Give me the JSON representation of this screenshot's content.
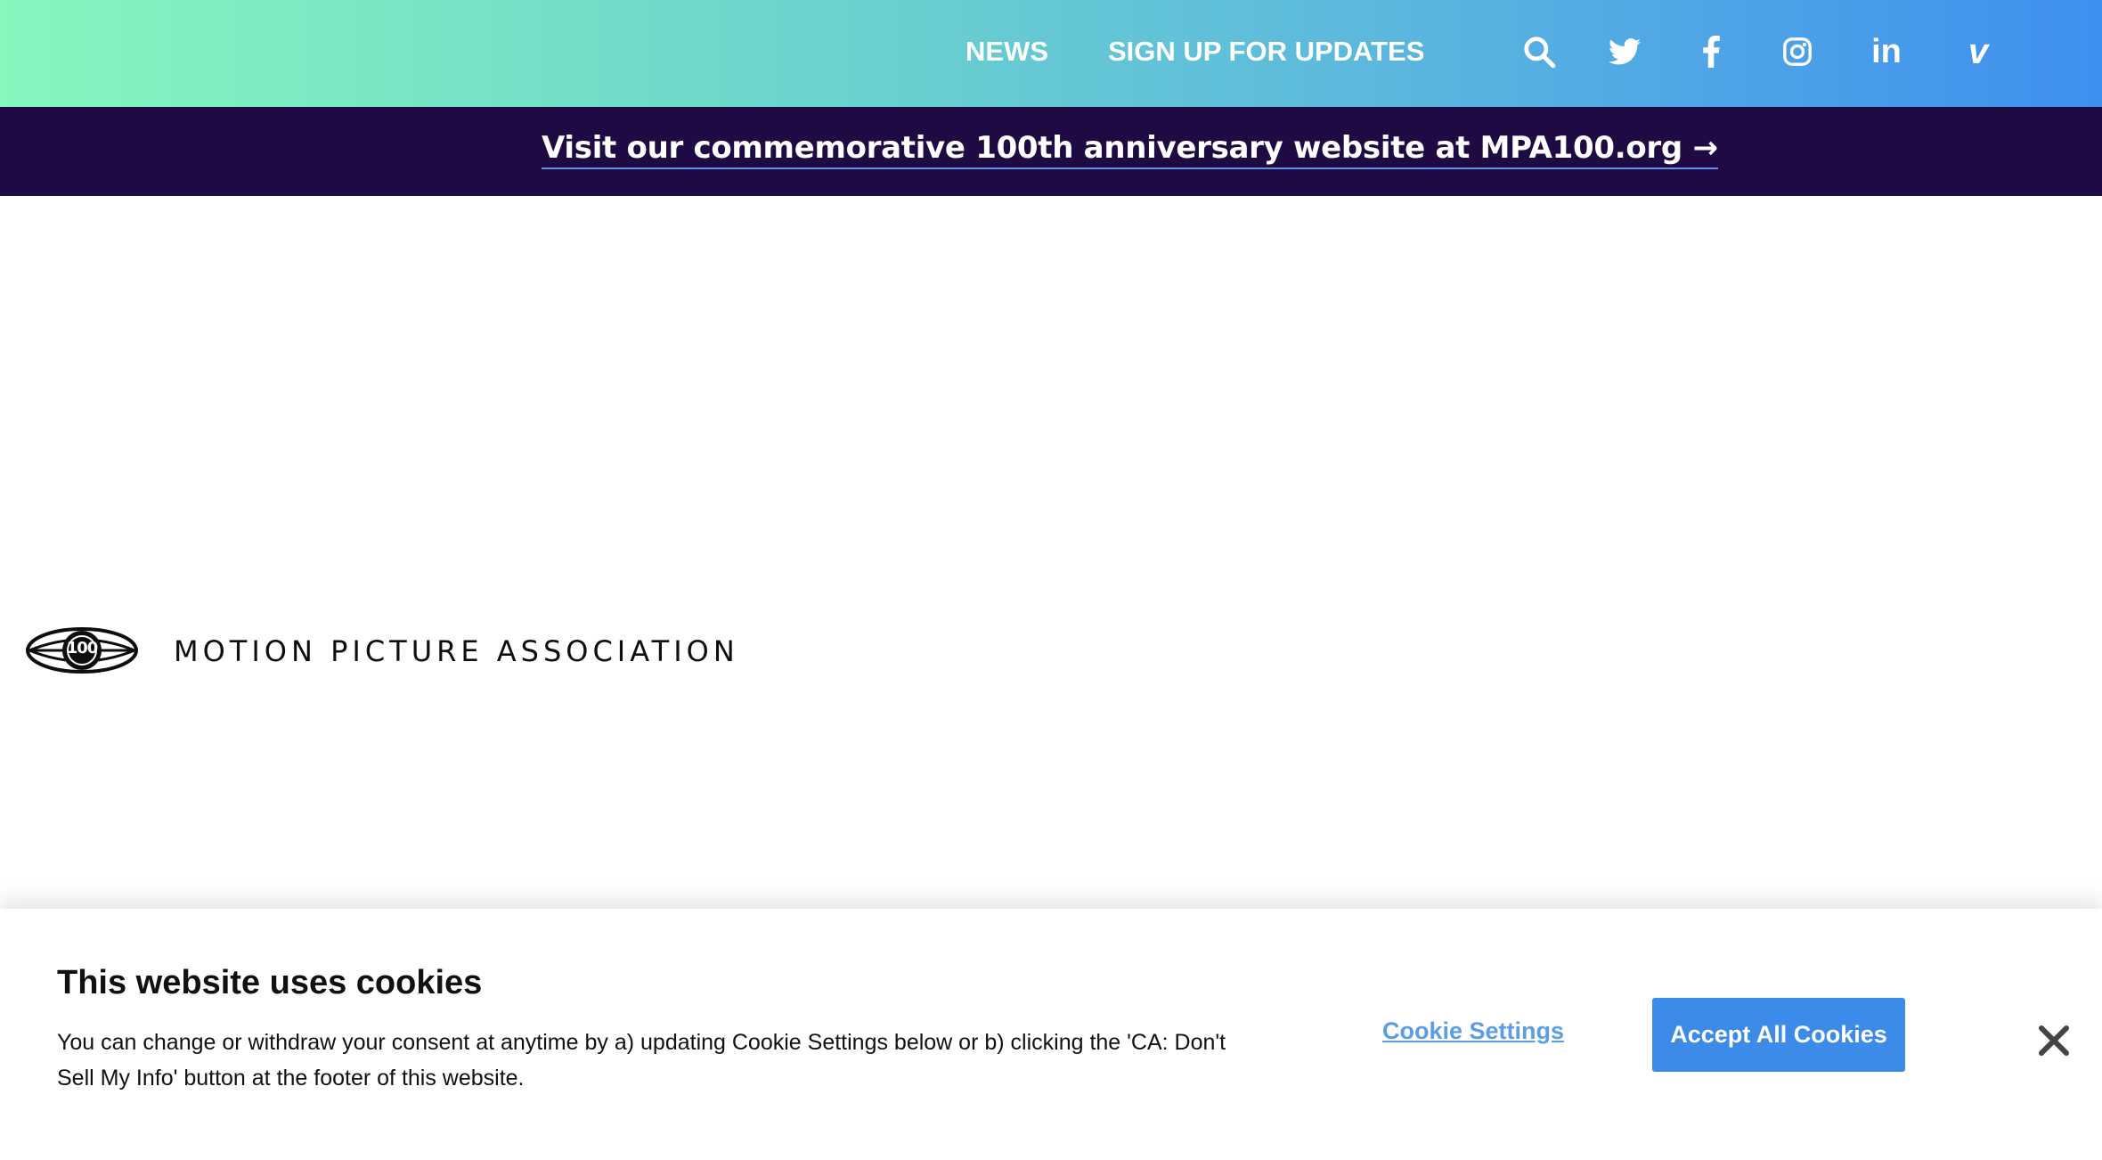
{
  "header": {
    "nav": [
      {
        "label": "NEWS"
      },
      {
        "label": "SIGN UP FOR UPDATES"
      }
    ],
    "icons": [
      "search-icon",
      "twitter-icon",
      "facebook-icon",
      "instagram-icon",
      "linkedin-icon",
      "vimeo-icon"
    ],
    "gradient_colors": [
      "#86f7bd",
      "#3f8fef"
    ]
  },
  "banner": {
    "text": "Visit our commemorative 100th anniversary website at MPA100.org →",
    "background": "#200a43"
  },
  "brand": {
    "logo_badge": "100",
    "name": "MOTION PICTURE ASSOCIATION"
  },
  "cookie_notice": {
    "title": "This website uses cookies",
    "description": "You can change or withdraw your consent at anytime by a) updating Cookie Settings below or b) clicking the 'CA: Don't Sell My Info' button at the footer of this website.",
    "settings_label": "Cookie Settings",
    "accept_label": "Accept All Cookies",
    "accent_color": "#3d8be9"
  }
}
